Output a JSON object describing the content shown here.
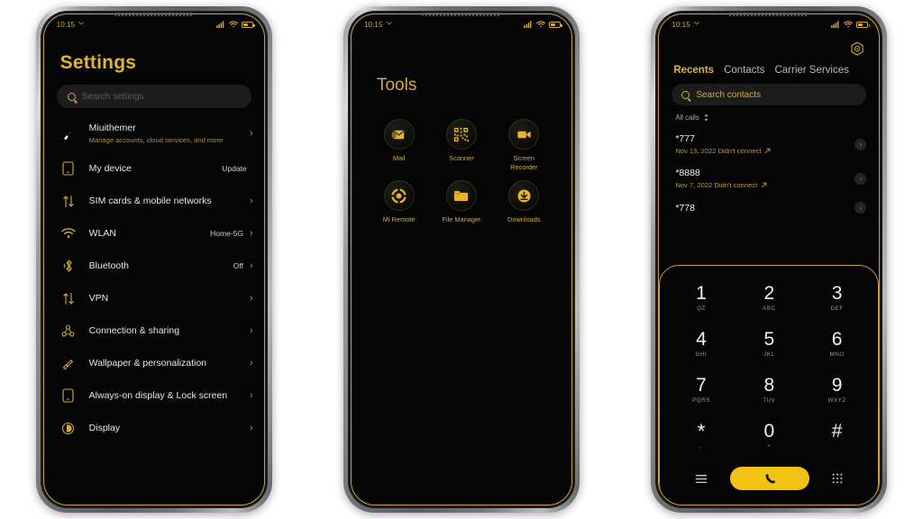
{
  "theme": {
    "gold": "#d6ab33",
    "gold_bright": "#e0b437",
    "call_yellow": "#f2c314",
    "screen_bg": "#050505",
    "frame_border": "#caa13a"
  },
  "status_bar": {
    "time": "10:15",
    "call_icon": "phone-call-icon",
    "signal_icon": "signal-bars-icon",
    "wifi_icon": "wifi-icon",
    "battery_icon": "battery-icon"
  },
  "phone1_settings": {
    "title": "Settings",
    "search": {
      "placeholder": "Search settings",
      "icon": "search-icon"
    },
    "items": [
      {
        "icon": "theme-brush-icon",
        "label": "Miuithemer",
        "sub": "Manage accounts, cloud services, and more",
        "value": "",
        "chevron": "›"
      },
      {
        "icon": "phone-device-icon",
        "label": "My device",
        "sub": "",
        "value": "Update",
        "chevron": ""
      },
      {
        "icon": "sim-transfer-icon",
        "label": "SIM cards & mobile networks",
        "sub": "",
        "value": "",
        "chevron": "›"
      },
      {
        "icon": "wifi-icon",
        "label": "WLAN",
        "sub": "",
        "value": "Home-5G",
        "chevron": "›"
      },
      {
        "icon": "bluetooth-icon",
        "label": "Bluetooth",
        "sub": "",
        "value": "Off",
        "chevron": "›"
      },
      {
        "icon": "vpn-transfer-icon",
        "label": "VPN",
        "sub": "",
        "value": "",
        "chevron": "›"
      },
      {
        "icon": "connection-share-icon",
        "label": "Connection & sharing",
        "sub": "",
        "value": "",
        "chevron": "›"
      },
      {
        "icon": "wallpaper-brush-icon",
        "label": "Wallpaper & personalization",
        "sub": "",
        "value": "",
        "chevron": "›"
      },
      {
        "icon": "lockscreen-icon",
        "label": "Always-on display & Lock screen",
        "sub": "",
        "value": "",
        "chevron": "›"
      },
      {
        "icon": "display-brightness-icon",
        "label": "Display",
        "sub": "",
        "value": "",
        "chevron": "›"
      }
    ]
  },
  "phone2_tools": {
    "title": "Tools",
    "apps": [
      {
        "icon": "mail-icon",
        "label": "Mail"
      },
      {
        "icon": "qr-scanner-icon",
        "label": "Scanner"
      },
      {
        "icon": "video-camera-icon",
        "label": "Screen Recorder"
      },
      {
        "icon": "mi-remote-icon",
        "label": "Mi Remote"
      },
      {
        "icon": "folder-icon",
        "label": "File Manager"
      },
      {
        "icon": "download-icon",
        "label": "Downloads"
      }
    ]
  },
  "phone3_dialer": {
    "gear_icon": "hex-settings-icon",
    "tabs": [
      {
        "label": "Recents",
        "active": true
      },
      {
        "label": "Contacts",
        "active": false
      },
      {
        "label": "Carrier Services",
        "active": false
      }
    ],
    "search": {
      "placeholder": "Search contacts",
      "icon": "search-icon"
    },
    "filter": {
      "label": "All calls",
      "icon": "sort-chevrons-icon"
    },
    "calls": [
      {
        "number": "*777",
        "meta": "Nov 13, 2022 Didn't connect",
        "direction_icon": "outgoing-arrow-icon",
        "info_icon": "info-chevron-icon"
      },
      {
        "number": "*8888",
        "meta": "Nov 7, 2022 Didn't connect",
        "direction_icon": "outgoing-arrow-icon",
        "info_icon": "info-chevron-icon"
      },
      {
        "number": "*778",
        "meta": "",
        "direction_icon": "",
        "info_icon": "info-chevron-icon"
      }
    ],
    "keypad": [
      {
        "digit": "1",
        "sub": "QZ"
      },
      {
        "digit": "2",
        "sub": "ABC"
      },
      {
        "digit": "3",
        "sub": "DEF"
      },
      {
        "digit": "4",
        "sub": "GHI"
      },
      {
        "digit": "5",
        "sub": "JKL"
      },
      {
        "digit": "6",
        "sub": "MNO"
      },
      {
        "digit": "7",
        "sub": "PQRS"
      },
      {
        "digit": "8",
        "sub": "TUV"
      },
      {
        "digit": "9",
        "sub": "WXYZ"
      },
      {
        "digit": "*",
        "sub": ","
      },
      {
        "digit": "0",
        "sub": "+"
      },
      {
        "digit": "#",
        "sub": ""
      }
    ],
    "actions": {
      "menu_icon": "hamburger-menu-icon",
      "call_icon": "phone-handset-icon",
      "keypad_icon": "keypad-dots-icon"
    }
  }
}
